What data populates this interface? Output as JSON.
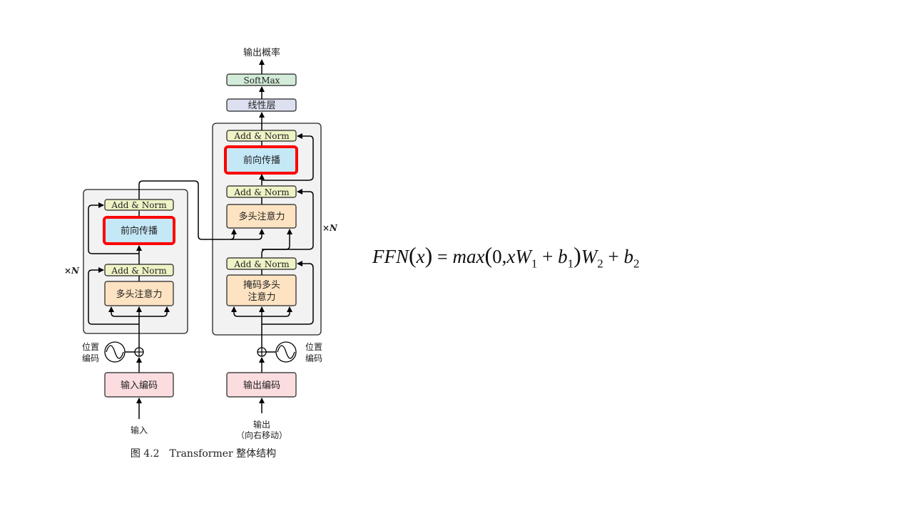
{
  "diagram": {
    "output_prob": "输出概率",
    "softmax": "SoftMax",
    "linear": "线性层",
    "add_norm": "Add & Norm",
    "ffn": "前向传播",
    "mha": "多头注意力",
    "masked_mha_line1": "掩码多头",
    "masked_mha_line2": "注意力",
    "repeat": "×N",
    "pos_enc_line1": "位置",
    "pos_enc_line2": "编码",
    "input_embed": "输入编码",
    "output_embed": "输出编码",
    "input": "输入",
    "output_line1": "输出",
    "output_line2": "（向右移动）",
    "caption": "图 4.2　Transformer 整体结构",
    "colors": {
      "add_norm": "#eff3c6",
      "ffn": "#c5e8f7",
      "mha": "#fde3c2",
      "embed": "#fbdde0",
      "softmax": "#d3ecd9",
      "linear": "#dde0f1",
      "highlight": "#ff0000",
      "block_bg": "#f2f2f2"
    }
  },
  "formula": {
    "lhs": "FFN",
    "arg": "x",
    "eq": "=",
    "fn": "max",
    "zero": "0,",
    "x": "xW",
    "s1": "1",
    "plus1": "+",
    "b1": "b",
    "s2": "1",
    "W2": "W",
    "s3": "2",
    "plus2": "+",
    "b2": "b",
    "s4": "2"
  }
}
